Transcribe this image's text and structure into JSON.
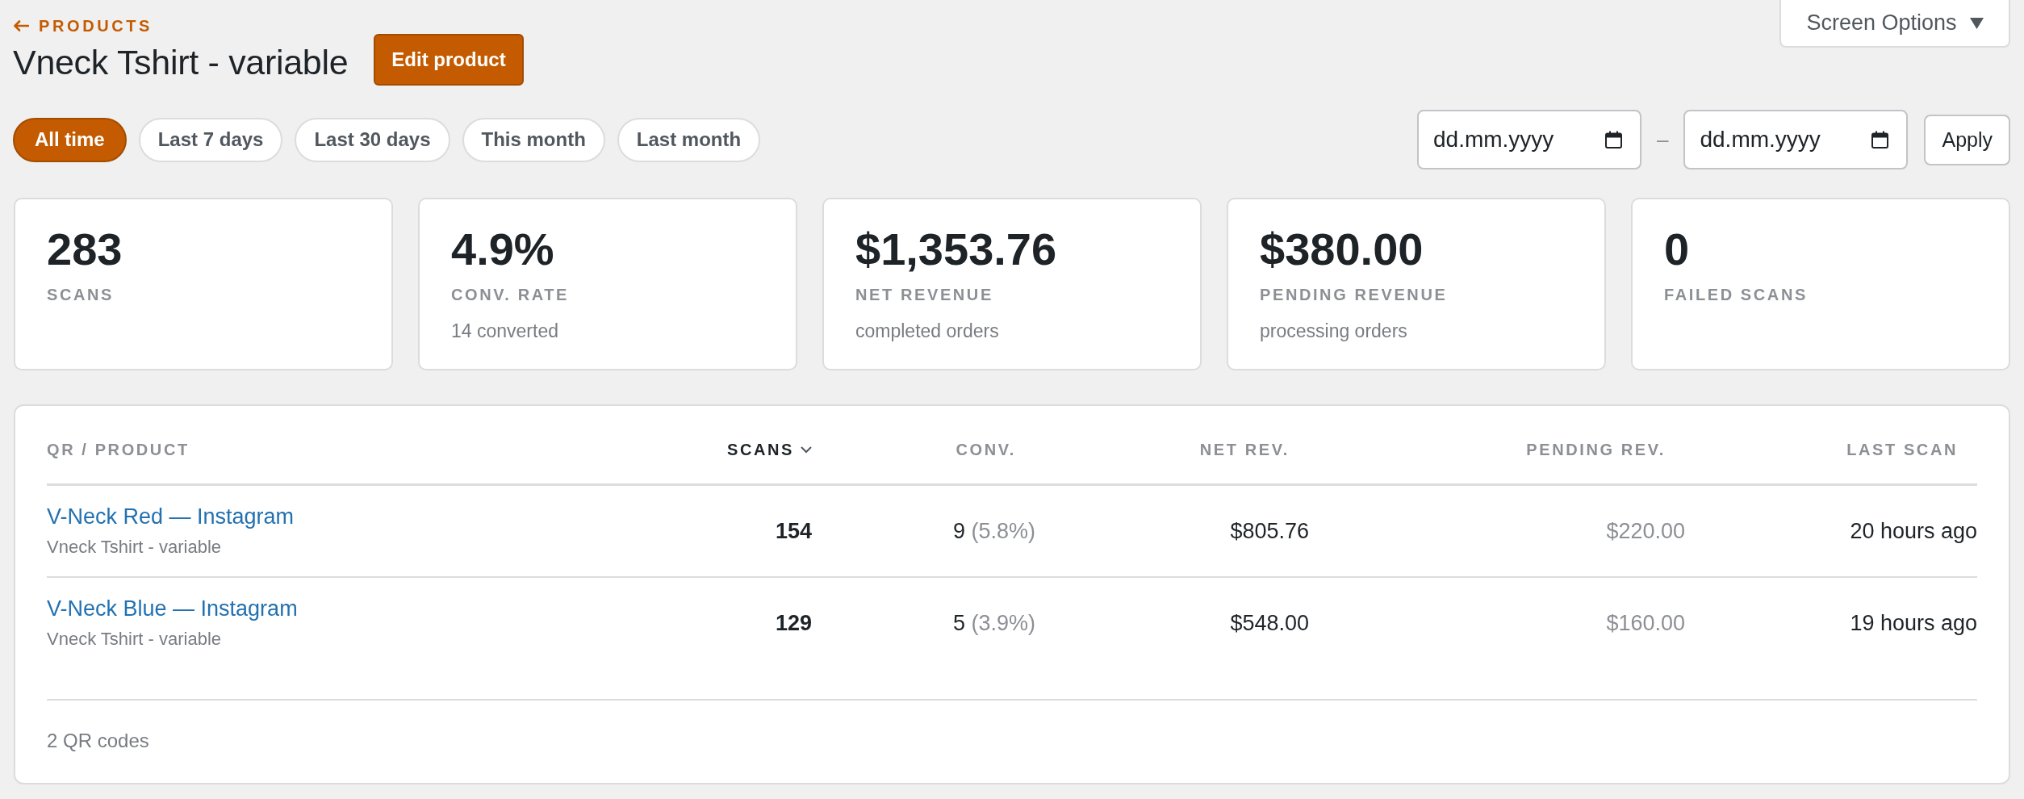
{
  "back_link": {
    "label": "PRODUCTS"
  },
  "title": "Vneck Tshirt - variable",
  "edit_button": {
    "label": "Edit product"
  },
  "screen_options": {
    "label": "Screen Options"
  },
  "date_filters": [
    {
      "label": "All time",
      "selected": true
    },
    {
      "label": "Last 7 days",
      "selected": false
    },
    {
      "label": "Last 30 days",
      "selected": false
    },
    {
      "label": "This month",
      "selected": false
    },
    {
      "label": "Last month",
      "selected": false
    }
  ],
  "date_range": {
    "from": {
      "placeholder": "dd.mm.yyyy"
    },
    "separator": "–",
    "to": {
      "placeholder": "dd.mm.yyyy"
    },
    "apply_button": "Apply"
  },
  "stats": [
    {
      "value": "283",
      "label": "SCANS"
    },
    {
      "value": "4.9%",
      "label": "CONV. RATE",
      "note": "14 converted"
    },
    {
      "value": "$1,353.76",
      "label": "NET REVENUE",
      "note": "completed orders"
    },
    {
      "value": "$380.00",
      "label": "PENDING REVENUE",
      "note": "processing orders"
    },
    {
      "value": "0",
      "label": "FAILED SCANS"
    }
  ],
  "table": {
    "columns": [
      {
        "label": "QR / PRODUCT",
        "sorted": false
      },
      {
        "label": "SCANS",
        "sorted": true
      },
      {
        "label": "CONV.",
        "sorted": false
      },
      {
        "label": "NET REV.",
        "sorted": false
      },
      {
        "label": "PENDING REV.",
        "sorted": false
      },
      {
        "label": "LAST SCAN",
        "sorted": false
      }
    ],
    "rows": [
      {
        "name": "V-Neck Red — Instagram",
        "product": "Vneck Tshirt - variable",
        "scans": "154",
        "conversions": "9",
        "conversion_rate": "(5.8%)",
        "net_revenue": "$805.76",
        "pending_revenue": "$220.00",
        "last_scan": "20 hours ago"
      },
      {
        "name": "V-Neck Blue — Instagram",
        "product": "Vneck Tshirt - variable",
        "scans": "129",
        "conversions": "5",
        "conversion_rate": "(3.9%)",
        "net_revenue": "$548.00",
        "pending_revenue": "$160.00",
        "last_scan": "19 hours ago"
      }
    ],
    "footer": "2 QR codes"
  }
}
